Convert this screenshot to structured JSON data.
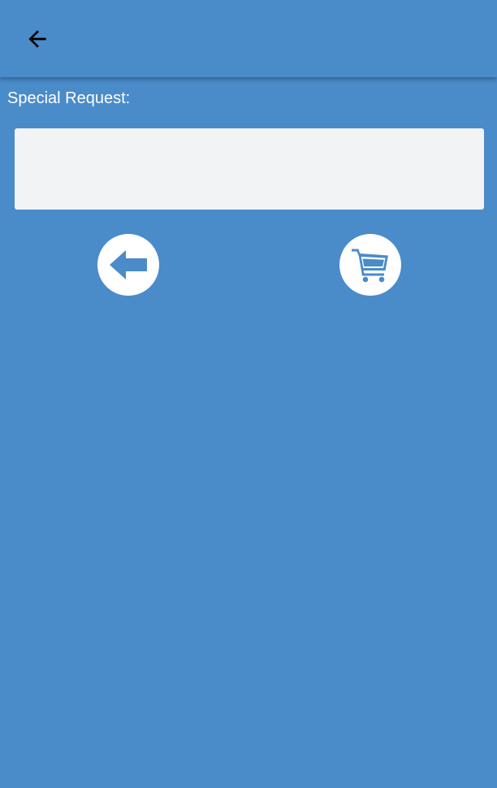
{
  "toolbar": {
    "back_icon": "arrow-left-icon"
  },
  "form": {
    "label": "Special Request:",
    "request_value": "",
    "request_placeholder": ""
  },
  "actions": {
    "back_icon": "circle-arrow-left-icon",
    "cart_icon": "shopping-cart-icon"
  },
  "colors": {
    "background": "#4a8bc9",
    "input_background": "#f2f3f5",
    "button_background": "#ffffff"
  }
}
